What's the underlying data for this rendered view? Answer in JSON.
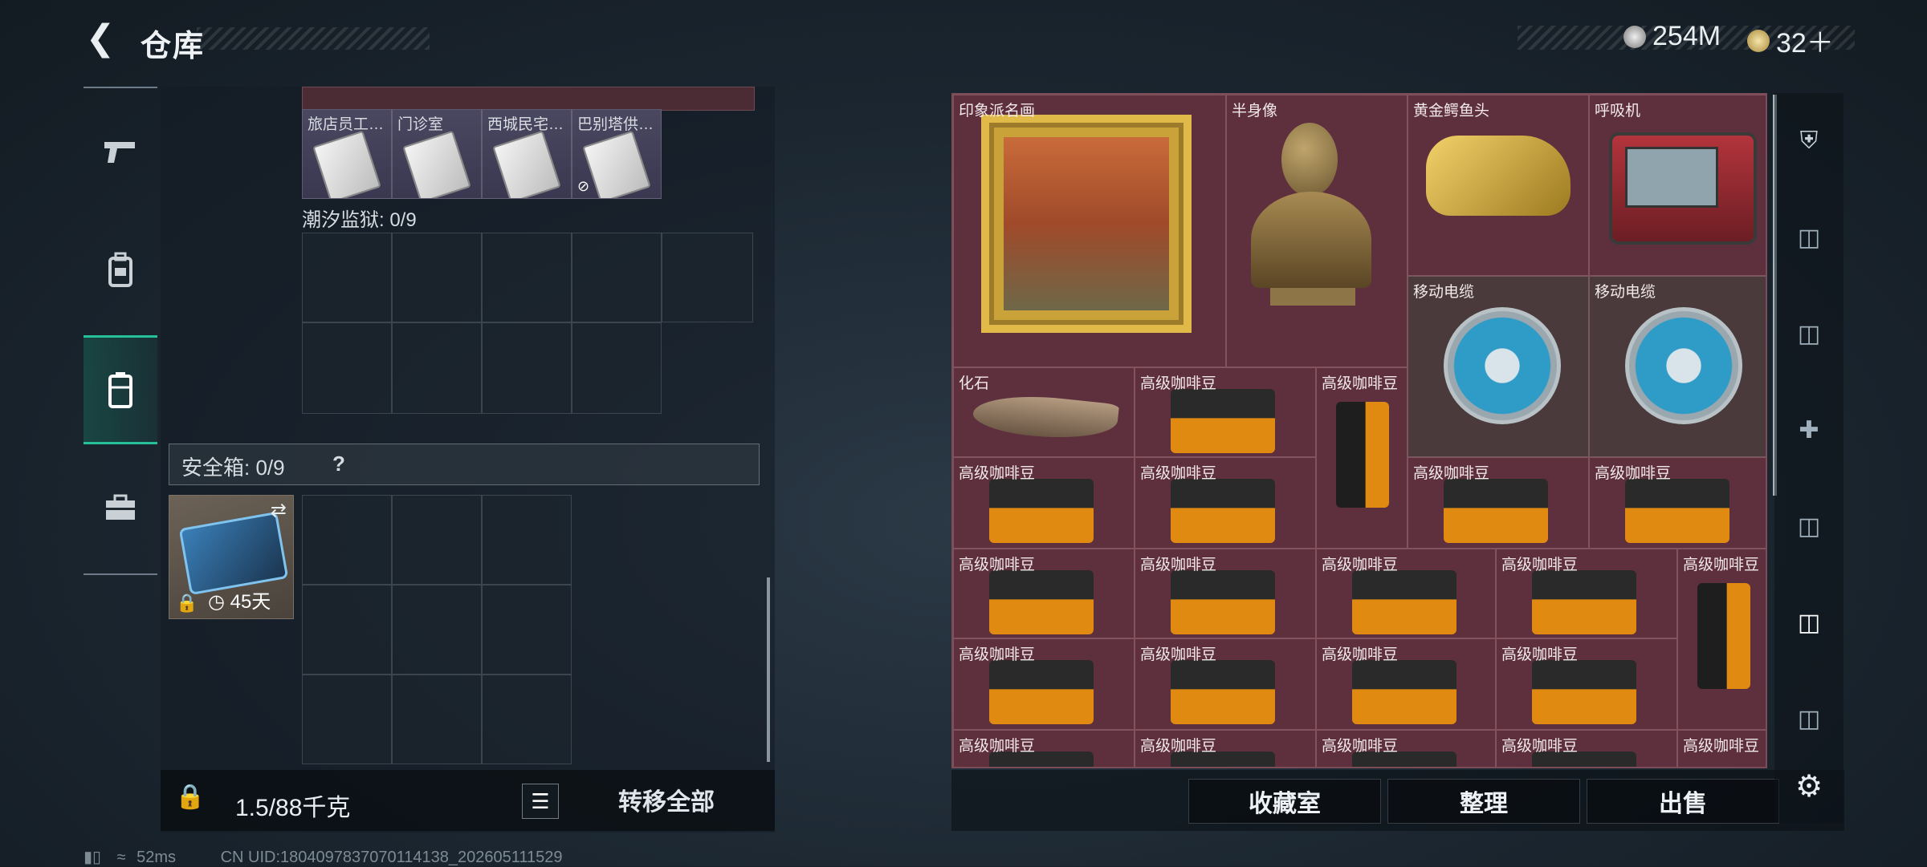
{
  "header": {
    "back_icon": "back-arrow-icon",
    "title": "仓库"
  },
  "currency": {
    "silver_value": "254M",
    "gold_value": "32＋"
  },
  "sidebar": {
    "items": [
      "pistol-icon",
      "backpack-icon",
      "container-icon",
      "briefcase-icon"
    ]
  },
  "left": {
    "doc_items": [
      "旅店员工…",
      "门诊室",
      "西城民宅…",
      "巴别塔供…"
    ],
    "tidal_prison_label": "潮汐监狱: 0/9",
    "safe_box_label": "安全箱: 0/9",
    "safe_box_help": "?",
    "case_timer": "45天",
    "weight_label": "1.5/88千克",
    "transfer_all": "转移全部"
  },
  "right": {
    "items": [
      {
        "name": "印象派名画"
      },
      {
        "name": "半身像"
      },
      {
        "name": "黄金鳄鱼头"
      },
      {
        "name": "呼吸机"
      },
      {
        "name": "移动电缆"
      },
      {
        "name": "移动电缆"
      },
      {
        "name": "化石"
      },
      {
        "name": "高级咖啡豆"
      }
    ],
    "buttons": {
      "collection": "收藏室",
      "organize": "整理",
      "sell": "出售"
    }
  },
  "status": {
    "ping": "52ms",
    "uid": "CN UID:1804097837070114138_202605111529"
  }
}
